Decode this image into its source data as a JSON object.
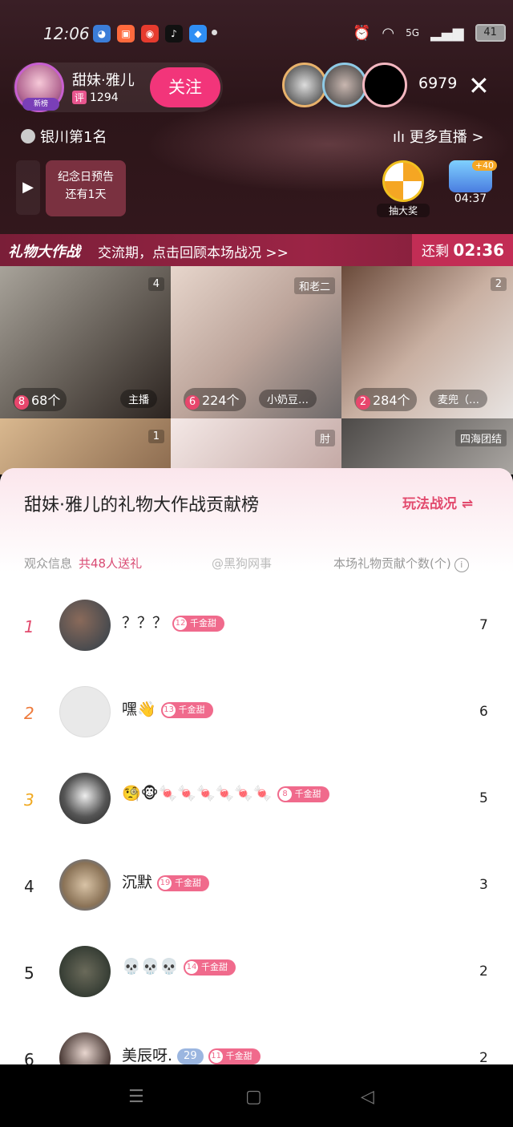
{
  "status": {
    "time": "12:06",
    "battery": "41",
    "network": "5G"
  },
  "host": {
    "name": "甜妹·雅儿",
    "level_tag": "评",
    "level_value": "1294",
    "badge": "新榜"
  },
  "follow_label": "关注",
  "viewer_count": "6979",
  "rank_text": "银川第1名",
  "more_live": "更多直播 >",
  "anniversary": {
    "line1": "纪念日预告",
    "line2": "还有1天"
  },
  "lottery_label": "抽大奖",
  "timer": {
    "plus": "+40",
    "value": "04:37"
  },
  "banner": {
    "title": "礼物大作战",
    "text": "交流期，点击回顾本场战况 >>",
    "remaining_label": "还剩",
    "remaining": "02:36"
  },
  "tiles": [
    {
      "num": "4",
      "rank": "8",
      "count": "68个",
      "role": "主播"
    },
    {
      "num": "和老二",
      "rank": "6",
      "count": "224个",
      "role": "小奶豆…"
    },
    {
      "num": "2",
      "rank": "2",
      "count": "284个",
      "role": "麦兜（…"
    },
    {
      "num": "1"
    },
    {
      "num": "肘"
    },
    {
      "num": "四海团结"
    }
  ],
  "panel": {
    "title": "甜妹·雅儿的礼物大作战贡献榜",
    "rules": "玩法战况 ⇌",
    "audience_label": "观众信息",
    "audience_count": "共48人送礼",
    "contrib_label": "本场礼物贡献个数(个)",
    "watermark": "@黑狗网事"
  },
  "rows": [
    {
      "rank": "1",
      "name": "？？？",
      "fan_level": "12",
      "fan_tag": "千金甜",
      "value": "7"
    },
    {
      "rank": "2",
      "name": "嘿👋",
      "fan_level": "13",
      "fan_tag": "千金甜",
      "value": "6"
    },
    {
      "rank": "3",
      "name": "🧐🐵🍬🍬🍬🍬🍬🍬",
      "fan_level": "8",
      "fan_tag": "千金甜",
      "value": "5"
    },
    {
      "rank": "4",
      "name": "沉默",
      "fan_level": "19",
      "fan_tag": "千金甜",
      "value": "3"
    },
    {
      "rank": "5",
      "name": "💀💀💀",
      "fan_level": "14",
      "fan_tag": "千金甜",
      "value": "2"
    },
    {
      "rank": "6",
      "name": "美辰呀.",
      "gem": "29",
      "fan_level": "11",
      "fan_tag": "千金甜",
      "value": "2"
    }
  ],
  "colors": {
    "accent": "#f2357a",
    "banner": "#9b2445",
    "rank1": "#e24a6d",
    "rank2": "#ee7a3b",
    "rank3": "#f0a81f"
  }
}
